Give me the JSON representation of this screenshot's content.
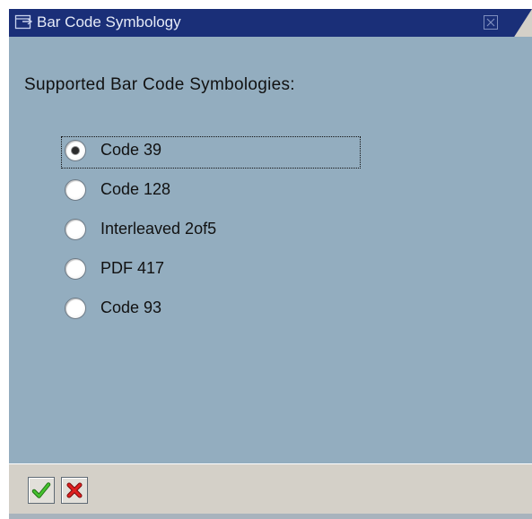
{
  "window": {
    "title": "Bar Code Symbology",
    "icon": "dialog-icon",
    "close_icon": "close-icon"
  },
  "main": {
    "heading": "Supported Bar Code Symbologies:",
    "options": [
      {
        "label": "Code 39",
        "selected": true
      },
      {
        "label": "Code 128",
        "selected": false
      },
      {
        "label": "Interleaved 2of5",
        "selected": false
      },
      {
        "label": "PDF 417",
        "selected": false
      },
      {
        "label": "Code 93",
        "selected": false
      }
    ]
  },
  "footer": {
    "confirm_icon": "checkmark-icon",
    "cancel_icon": "cancel-x-icon"
  },
  "colors": {
    "titlebar": "#1a2f78",
    "body": "#93adbf",
    "footer": "#d4d0c8",
    "confirm": "#2e9a1f",
    "cancel": "#d11a1a"
  }
}
